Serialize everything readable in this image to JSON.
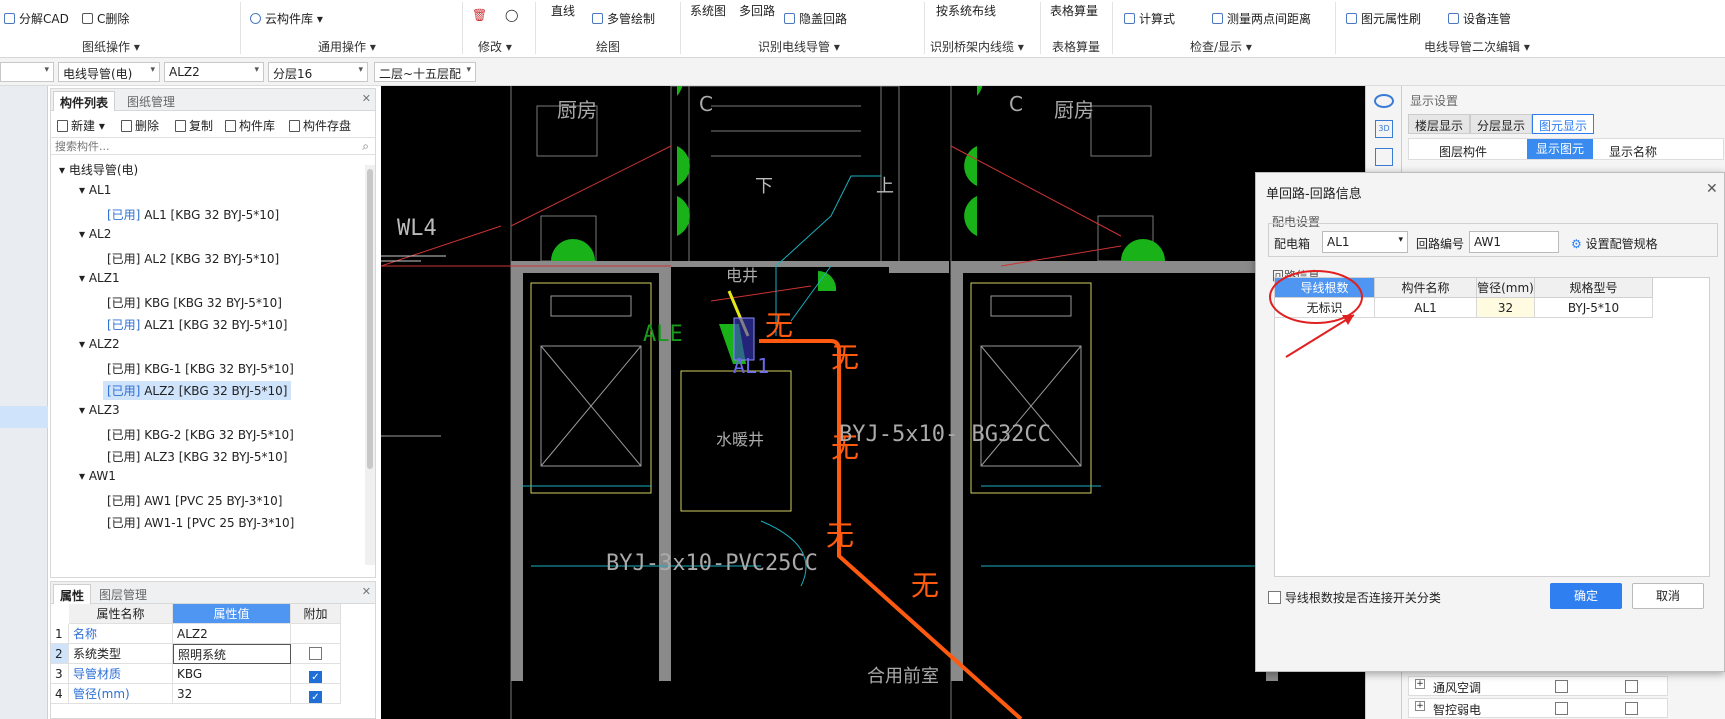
{
  "ribbon": {
    "items": {
      "split_cad": "分解CAD",
      "c_delete": "C删除",
      "cloud_lib": "云构件库",
      "straight_line": "直线",
      "multi_pipe_draw": "多管绘制",
      "system_diagram": "系统图",
      "multi_circuit": "多回路",
      "hide_circuit": "隐盖回路",
      "by_system_wiring": "按系统布线",
      "table_calc": "表格算量",
      "formula": "计算式",
      "measure_distance": "测量两点间距离",
      "element_props": "图元属性刷",
      "device_pipe": "设备连管"
    },
    "groups": {
      "drawing_ops": "图纸操作",
      "common_ops": "通用操作",
      "modify": "修改",
      "draw": "绘图",
      "identify_conduit": "识别电线导管",
      "identify_bridge": "识别桥架内线缆",
      "table_calc": "表格算量",
      "check_display": "检查/显示",
      "conduit_secondary": "电线导管二次编辑"
    }
  },
  "filterbar": {
    "type": "电线导管(电)",
    "component": "ALZ2",
    "layer": "分层16",
    "floor": "二层~十五层配"
  },
  "component_panel": {
    "tabs": [
      "构件列表",
      "图纸管理"
    ],
    "toolbar": {
      "new": "新建",
      "delete": "删除",
      "copy": "复制",
      "lib": "构件库",
      "store": "构件存盘"
    },
    "search_placeholder": "搜索构件...",
    "root": "电线导管(电)",
    "groups": [
      {
        "name": "AL1",
        "items": [
          {
            "tag": "[已用]",
            "text": " AL1 [KBG 32 BYJ-5*10]",
            "tagblue": true
          }
        ]
      },
      {
        "name": "AL2",
        "items": [
          {
            "tag": "[已用]",
            "text": " AL2 [KBG 32 BYJ-5*10]",
            "tagblue": false
          }
        ]
      },
      {
        "name": "ALZ1",
        "items": [
          {
            "tag": "[已用]",
            "text": " KBG [KBG 32 BYJ-5*10]",
            "tagblue": false
          },
          {
            "tag": "[已用]",
            "text": " ALZ1 [KBG 32 BYJ-5*10]",
            "tagblue": true
          }
        ]
      },
      {
        "name": "ALZ2",
        "items": [
          {
            "tag": "[已用]",
            "text": " KBG-1 [KBG 32 BYJ-5*10]",
            "tagblue": false
          },
          {
            "tag": "[已用]",
            "text": " ALZ2 [KBG 32 BYJ-5*10]",
            "tagblue": true,
            "selected": true
          }
        ]
      },
      {
        "name": "ALZ3",
        "items": [
          {
            "tag": "[已用]",
            "text": " KBG-2 [KBG 32 BYJ-5*10]",
            "tagblue": false
          },
          {
            "tag": "[已用]",
            "text": " ALZ3 [KBG 32 BYJ-5*10]",
            "tagblue": false
          }
        ]
      },
      {
        "name": "AW1",
        "items": [
          {
            "tag": "[已用]",
            "text": " AW1 [PVC 25 BYJ-3*10]",
            "tagblue": false
          },
          {
            "tag": "[已用]",
            "text": " AW1-1 [PVC 25 BYJ-3*10]",
            "tagblue": false
          }
        ]
      }
    ]
  },
  "props_panel": {
    "tabs": [
      "属性",
      "图层管理"
    ],
    "headers": [
      "属性名称",
      "属性值",
      "附加"
    ],
    "rows": [
      {
        "n": "1",
        "name": "名称",
        "value": "ALZ2",
        "blue": true,
        "check": null
      },
      {
        "n": "2",
        "name": "系统类型",
        "value": "照明系统",
        "blue": false,
        "check": false
      },
      {
        "n": "3",
        "name": "导管材质",
        "value": "KBG",
        "blue": true,
        "check": true
      },
      {
        "n": "4",
        "name": "管径(mm)",
        "value": "32",
        "blue": true,
        "check": true
      }
    ]
  },
  "cad": {
    "labels": {
      "kitchen": "厨房",
      "kitchen2": "厨房",
      "down": "下",
      "up": "上",
      "wl4": "WL4",
      "elec_shaft": "电井",
      "water_shaft": "水暖井",
      "ale": "ALE",
      "al1": "AL1",
      "wu": "无",
      "byj5": "BYJ-5x10- BG32CC",
      "byj3": "BYJ-3x10-PVC25CC",
      "shared_lobby": "合用前室",
      "c": "C"
    }
  },
  "display_panel": {
    "title": "显示设置",
    "tabs": [
      "楼层显示",
      "分层显示",
      "图元显示"
    ],
    "headers": [
      "图层构件",
      "显示图元",
      "显示名称"
    ],
    "rows": [
      {
        "label": "通风空调"
      },
      {
        "label": "智控弱电"
      }
    ]
  },
  "dialog": {
    "title": "单回路-回路信息",
    "section1": "配电设置",
    "box_label": "配电箱",
    "box_value": "AL1",
    "circuit_label": "回路编号",
    "circuit_value": "AW1",
    "settings_btn": "设置配管规格",
    "section2": "回路信息",
    "headers": [
      "导线根数",
      "构件名称",
      "管径(mm)",
      "规格型号"
    ],
    "row": [
      "无标识",
      "AL1",
      "32",
      "BYJ-5*10"
    ],
    "checkbox_label": "导线根数按是否连接开关分类",
    "ok": "确定",
    "cancel": "取消"
  }
}
